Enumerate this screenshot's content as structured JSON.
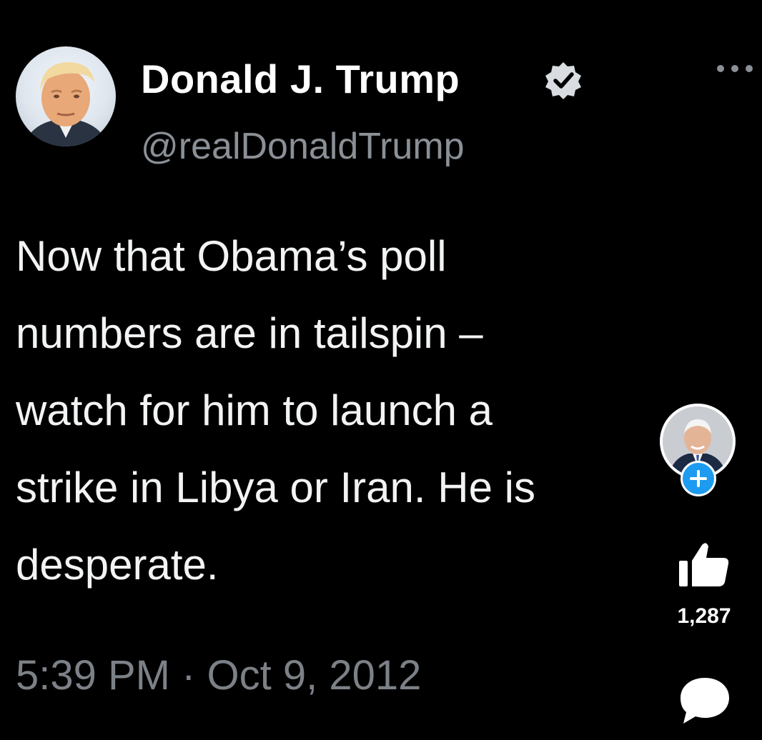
{
  "tweet": {
    "author_name": "Donald J. Trump",
    "author_handle": "@realDonaldTrump",
    "text": "Now that Obama’s poll\nnumbers are in tailspin –\nwatch for him to launch a\nstrike in Libya or Iran.  He is\ndesperate.",
    "timestamp": "5:39 PM · Oct 9, 2012",
    "verified_badge": "verified-badge-icon",
    "more_menu": "more-dots-icon"
  },
  "overlay": {
    "follow_icon": "plus-icon",
    "like_icon": "thumbs-up-icon",
    "like_count": "1,287",
    "comment_icon": "comment-bubble-icon"
  },
  "colors": {
    "background": "#000000",
    "handle_gray": "#8a9096",
    "timestamp_gray": "#7c8187",
    "accent_blue": "#1d9bf0"
  }
}
